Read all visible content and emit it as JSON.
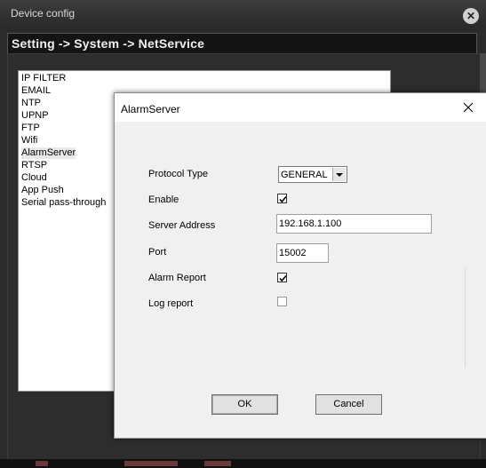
{
  "outer_window": {
    "title": "Device config",
    "close_label": "✕",
    "breadcrumb": "Setting -> System -> NetService"
  },
  "services": {
    "items": [
      {
        "label": "IP FILTER"
      },
      {
        "label": "EMAIL"
      },
      {
        "label": "NTP"
      },
      {
        "label": "UPNP"
      },
      {
        "label": "FTP"
      },
      {
        "label": "Wifi"
      },
      {
        "label": "AlarmServer",
        "selected": true
      },
      {
        "label": "RTSP"
      },
      {
        "label": "Cloud"
      },
      {
        "label": "App Push"
      },
      {
        "label": "Serial pass-through"
      }
    ]
  },
  "dialog": {
    "title": "AlarmServer",
    "protocol_type": {
      "label": "Protocol Type",
      "value": "GENERAL"
    },
    "enable": {
      "label": "Enable",
      "checked": true
    },
    "server_address": {
      "label": "Server Address",
      "value": "192.168.1.100"
    },
    "port": {
      "label": "Port",
      "value": "15002"
    },
    "alarm_report": {
      "label": "Alarm Report",
      "checked": true
    },
    "log_report": {
      "label": "Log report",
      "checked": false
    },
    "ok_label": "OK",
    "cancel_label": "Cancel"
  }
}
